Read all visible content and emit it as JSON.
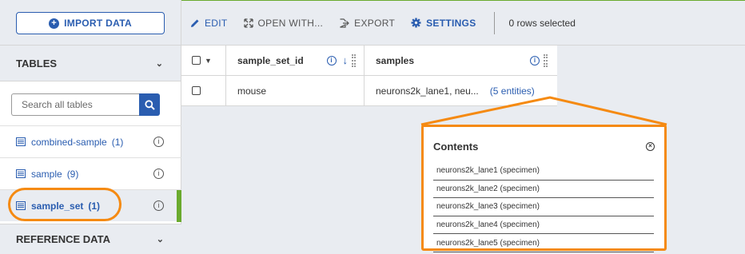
{
  "sidebar": {
    "import_label": "IMPORT DATA",
    "tables_heading": "TABLES",
    "search_placeholder": "Search all tables",
    "tables": [
      {
        "label": "combined-sample",
        "count": "(1)"
      },
      {
        "label": "sample",
        "count": "(9)"
      },
      {
        "label": "sample_set",
        "count": "(1)"
      }
    ],
    "reference_heading": "REFERENCE DATA"
  },
  "toolbar": {
    "edit": "EDIT",
    "open_with": "OPEN WITH...",
    "export": "EXPORT",
    "settings": "SETTINGS",
    "rows_selected": "0 rows selected"
  },
  "grid": {
    "columns": [
      "sample_set_id",
      "samples"
    ],
    "rows": [
      {
        "sample_set_id": "mouse",
        "samples_text": "neurons2k_lane1,  neu...",
        "samples_link": "(5 entities)"
      }
    ]
  },
  "popup": {
    "title": "Contents",
    "items": [
      "neurons2k_lane1 (specimen)",
      "neurons2k_lane2 (specimen)",
      "neurons2k_lane3 (specimen)",
      "neurons2k_lane4 (specimen)",
      "neurons2k_lane5 (specimen)"
    ]
  },
  "colors": {
    "accent": "#2a5db0",
    "highlight": "#f58a12",
    "active_bar": "#6aaa2e"
  }
}
